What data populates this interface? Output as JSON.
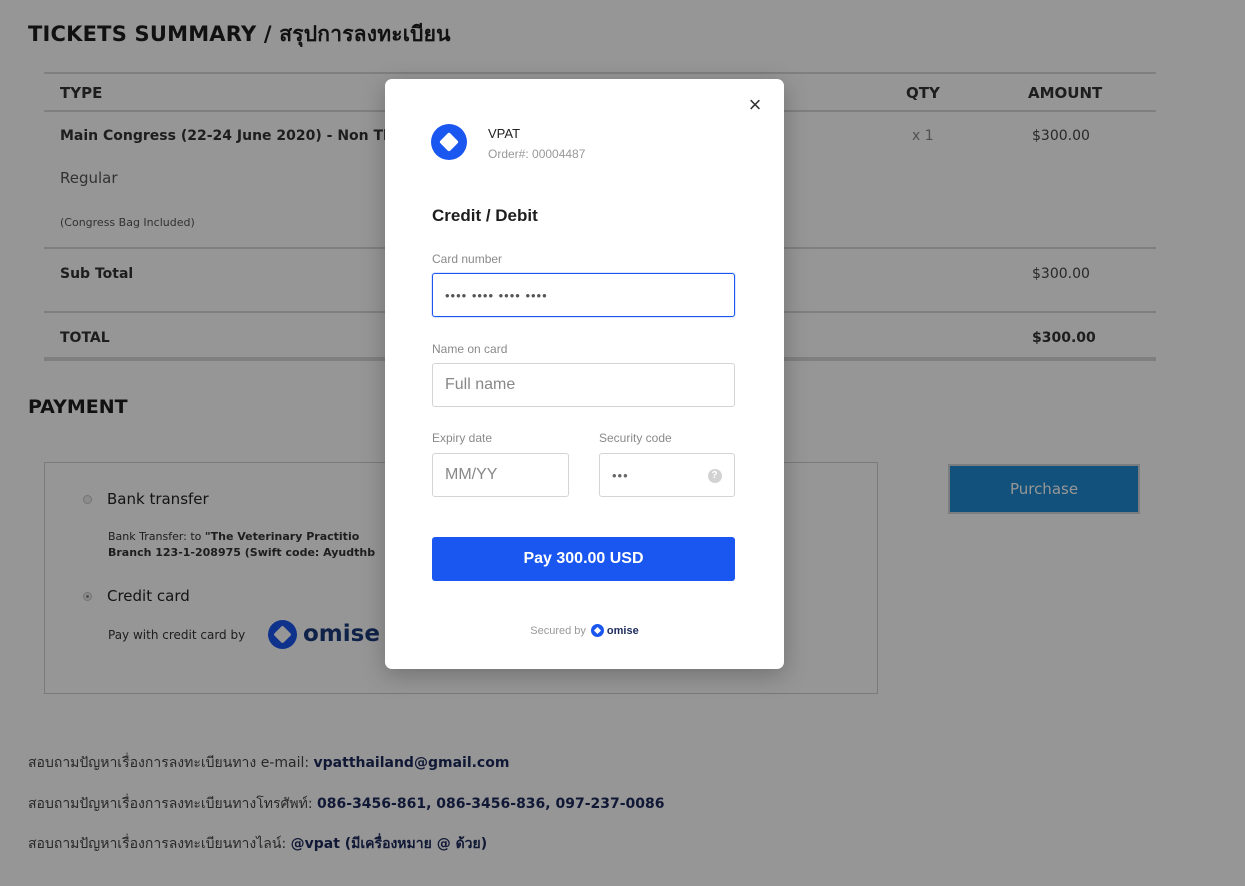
{
  "summary": {
    "title": "TICKETS SUMMARY / สรุปการลงทะเบียน",
    "headers": {
      "type": "TYPE",
      "qty": "QTY",
      "amount": "AMOUNT"
    },
    "item": {
      "name": "Main Congress (22-24 June 2020) - Non Tha",
      "tier": "Regular",
      "note": "(Congress Bag Included)",
      "qty": "x 1",
      "amount": "$300.00"
    },
    "subtotal": {
      "label": "Sub Total",
      "amount": "$300.00"
    },
    "total": {
      "label": "TOTAL",
      "amount": "$300.00"
    }
  },
  "payment": {
    "title": "PAYMENT",
    "bank": {
      "label": "Bank transfer",
      "line1_prefix": "Bank Transfer: to ",
      "line1_bold": "\"The Veterinary Practitio",
      "line2_bold": "Branch 123-1-208975 (Swift code: Ayudthb"
    },
    "card": {
      "label": "Credit card",
      "text": "Pay with credit card by",
      "brand": "omise"
    },
    "purchase_label": "Purchase"
  },
  "contacts": [
    {
      "prefix": "สอบถามปัญหาเรื่องการลงทะเบียนทาง e-mail: ",
      "value": "vpatthailand@gmail.com"
    },
    {
      "prefix": "สอบถามปัญหาเรื่องการลงทะเบียนทางโทรศัพท์: ",
      "value": "086-3456-861, 086-3456-836, 097-237-0086"
    },
    {
      "prefix": "สอบถามปัญหาเรื่องการลงทะเบียนทางไลน์: ",
      "value": "@vpat (มีเครื่องหมาย @ ด้วย)"
    }
  ],
  "modal": {
    "close_glyph": "×",
    "merchant": "VPAT",
    "order": "Order#: 00004487",
    "form_title": "Credit / Debit",
    "card_number": {
      "label": "Card number",
      "value": "•••• •••• •••• ••••"
    },
    "name": {
      "label": "Name on card",
      "placeholder": "Full name"
    },
    "expiry": {
      "label": "Expiry date",
      "placeholder": "MM/YY"
    },
    "security": {
      "label": "Security code",
      "value": "•••",
      "help_glyph": "?"
    },
    "pay_label": "Pay 300.00 USD",
    "secured_text": "Secured by",
    "secured_brand": "omise"
  },
  "colors": {
    "overlay": "rgba(0,0,0,0.41)",
    "omise_blue": "#1a56f0",
    "purchase_blue": "#1e8bd1"
  }
}
